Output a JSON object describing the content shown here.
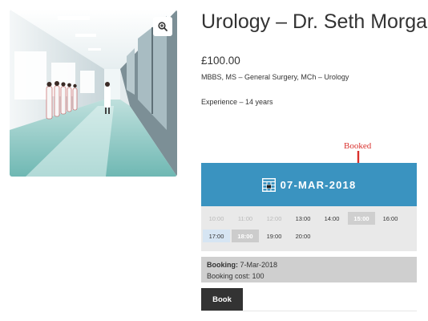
{
  "product": {
    "title": "Urology – Dr. Seth Morgan",
    "price": "£100.00",
    "qualifications": "MBBS, MS – General Surgery, MCh – Urology",
    "experience": "Experience – 14 years"
  },
  "image": {
    "zoom_icon": "magnify-plus-icon"
  },
  "annotation": {
    "label": "Booked",
    "color": "#d9302c"
  },
  "calendar": {
    "icon": "calendar-grid-icon",
    "date": "07-MAR-2018",
    "header_color": "#3a93c0"
  },
  "slots": {
    "row1": [
      {
        "time": "10:00",
        "state": "past"
      },
      {
        "time": "11:00",
        "state": "past"
      },
      {
        "time": "12:00",
        "state": "past"
      },
      {
        "time": "13:00",
        "state": "available"
      },
      {
        "time": "14:00",
        "state": "available"
      },
      {
        "time": "15:00",
        "state": "booked"
      },
      {
        "time": "16:00",
        "state": "available"
      }
    ],
    "row2": [
      {
        "time": "17:00",
        "state": "selected"
      },
      {
        "time": "18:00",
        "state": "blocked"
      },
      {
        "time": "19:00",
        "state": "available"
      },
      {
        "time": "20:00",
        "state": "available"
      }
    ]
  },
  "summary": {
    "booking_label": "Booking:",
    "booking_value": "7-Mar-2018",
    "cost_label": "Booking cost:",
    "cost_value": "100"
  },
  "actions": {
    "book_label": "Book"
  }
}
